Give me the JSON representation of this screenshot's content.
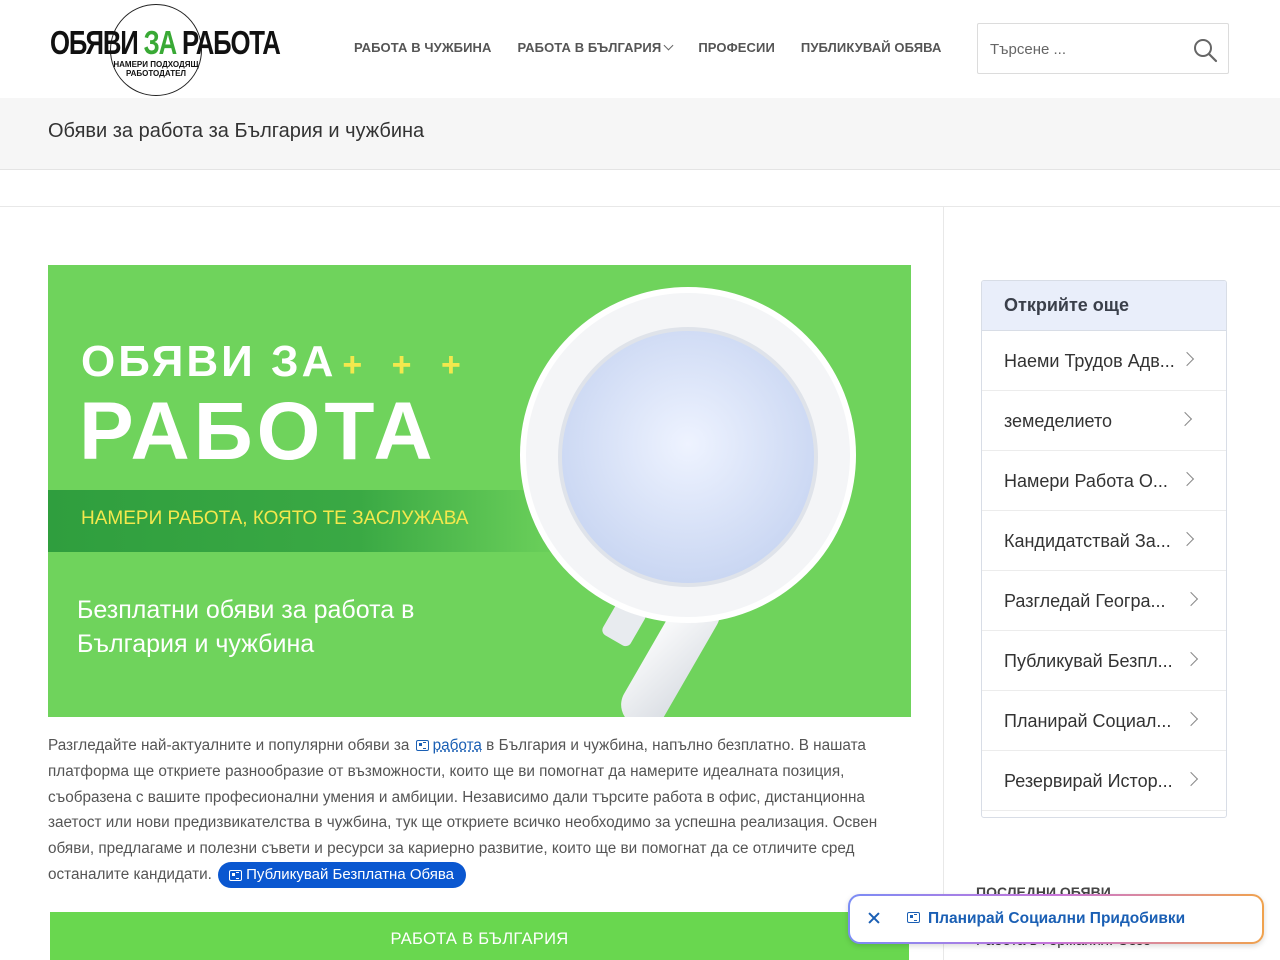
{
  "header": {
    "logo": {
      "main_left": "ОБЯВИ ",
      "main_accent": "ЗА",
      "main_right": " РАБОТА",
      "tagline": "НАМЕРИ ПОДХОДЯЩ РАБОТОДАТЕЛ"
    },
    "nav": [
      {
        "label": "РАБОТА В ЧУЖБИНА",
        "dropdown": false
      },
      {
        "label": "РАБОТА В БЪЛГАРИЯ",
        "dropdown": true
      },
      {
        "label": "ПРОФЕСИИ",
        "dropdown": false
      },
      {
        "label": "ПУБЛИКУВАЙ ОБЯВА",
        "dropdown": false
      }
    ],
    "search": {
      "placeholder": "Търсене ...",
      "icon": "search-icon"
    }
  },
  "page": {
    "title": "Обяви за работа за България и чужбина"
  },
  "banner": {
    "title_line1": "ОБЯВИ ЗА",
    "plus_signs": "+ + +",
    "title_line2": "РАБОТА",
    "strip": "НАМЕРИ РАБОТА, КОЯТО ТЕ ЗАСЛУЖАВА",
    "description": "Безплатни обяви за работа в България и чужбина",
    "colors": {
      "background": "#6fd35c",
      "accent": "#f3e84d"
    }
  },
  "intro": {
    "before_link": "Разгледайте най-актуалните и популярни обяви за ",
    "link": "работа",
    "after_link": " в България и чужбина, напълно безплатно. В нашата платформа ще откриете разнообразие от възможности, които ще ви помогнат да намерите идеалната позиция, съобразена с вашите професионални умения и амбиции. Независимо дали търсите работа в офис, дистанционна заетост или нови предизвикателства в чужбина, тук ще откриете всичко необходимо за успешна реализация. Освен обяви, предлагаме и полезни съвети и ресурси за кариерно развитие, които ще ви помогнат да се отличите сред останалите кандидати.",
    "pill": "Публикувай Безплатна Обява"
  },
  "main_button": "РАБОТА В БЪЛГАРИЯ",
  "sidebar": {
    "title": "Открийте още",
    "items": [
      "Наеми Трудов Адв...",
      "земеделието",
      "Намери Работа О...",
      "Кандидатствай За...",
      "Разгледай Геогра...",
      "Публикувай Безпл...",
      "Планирай Социал...",
      "Резервирай Истор..."
    ],
    "latest_title": "ПОСЛЕДНИ ОБЯВИ",
    "latest_first": "Работа в Германия: Сезо"
  },
  "floating_chip": {
    "label": "Планирай Социални Придобивки",
    "close_icon": "close-icon"
  },
  "colors": {
    "brand_green": "#39a935",
    "button_green": "#69d74f",
    "link_blue": "#1a5fb4",
    "pill_blue": "#0a57d0"
  }
}
